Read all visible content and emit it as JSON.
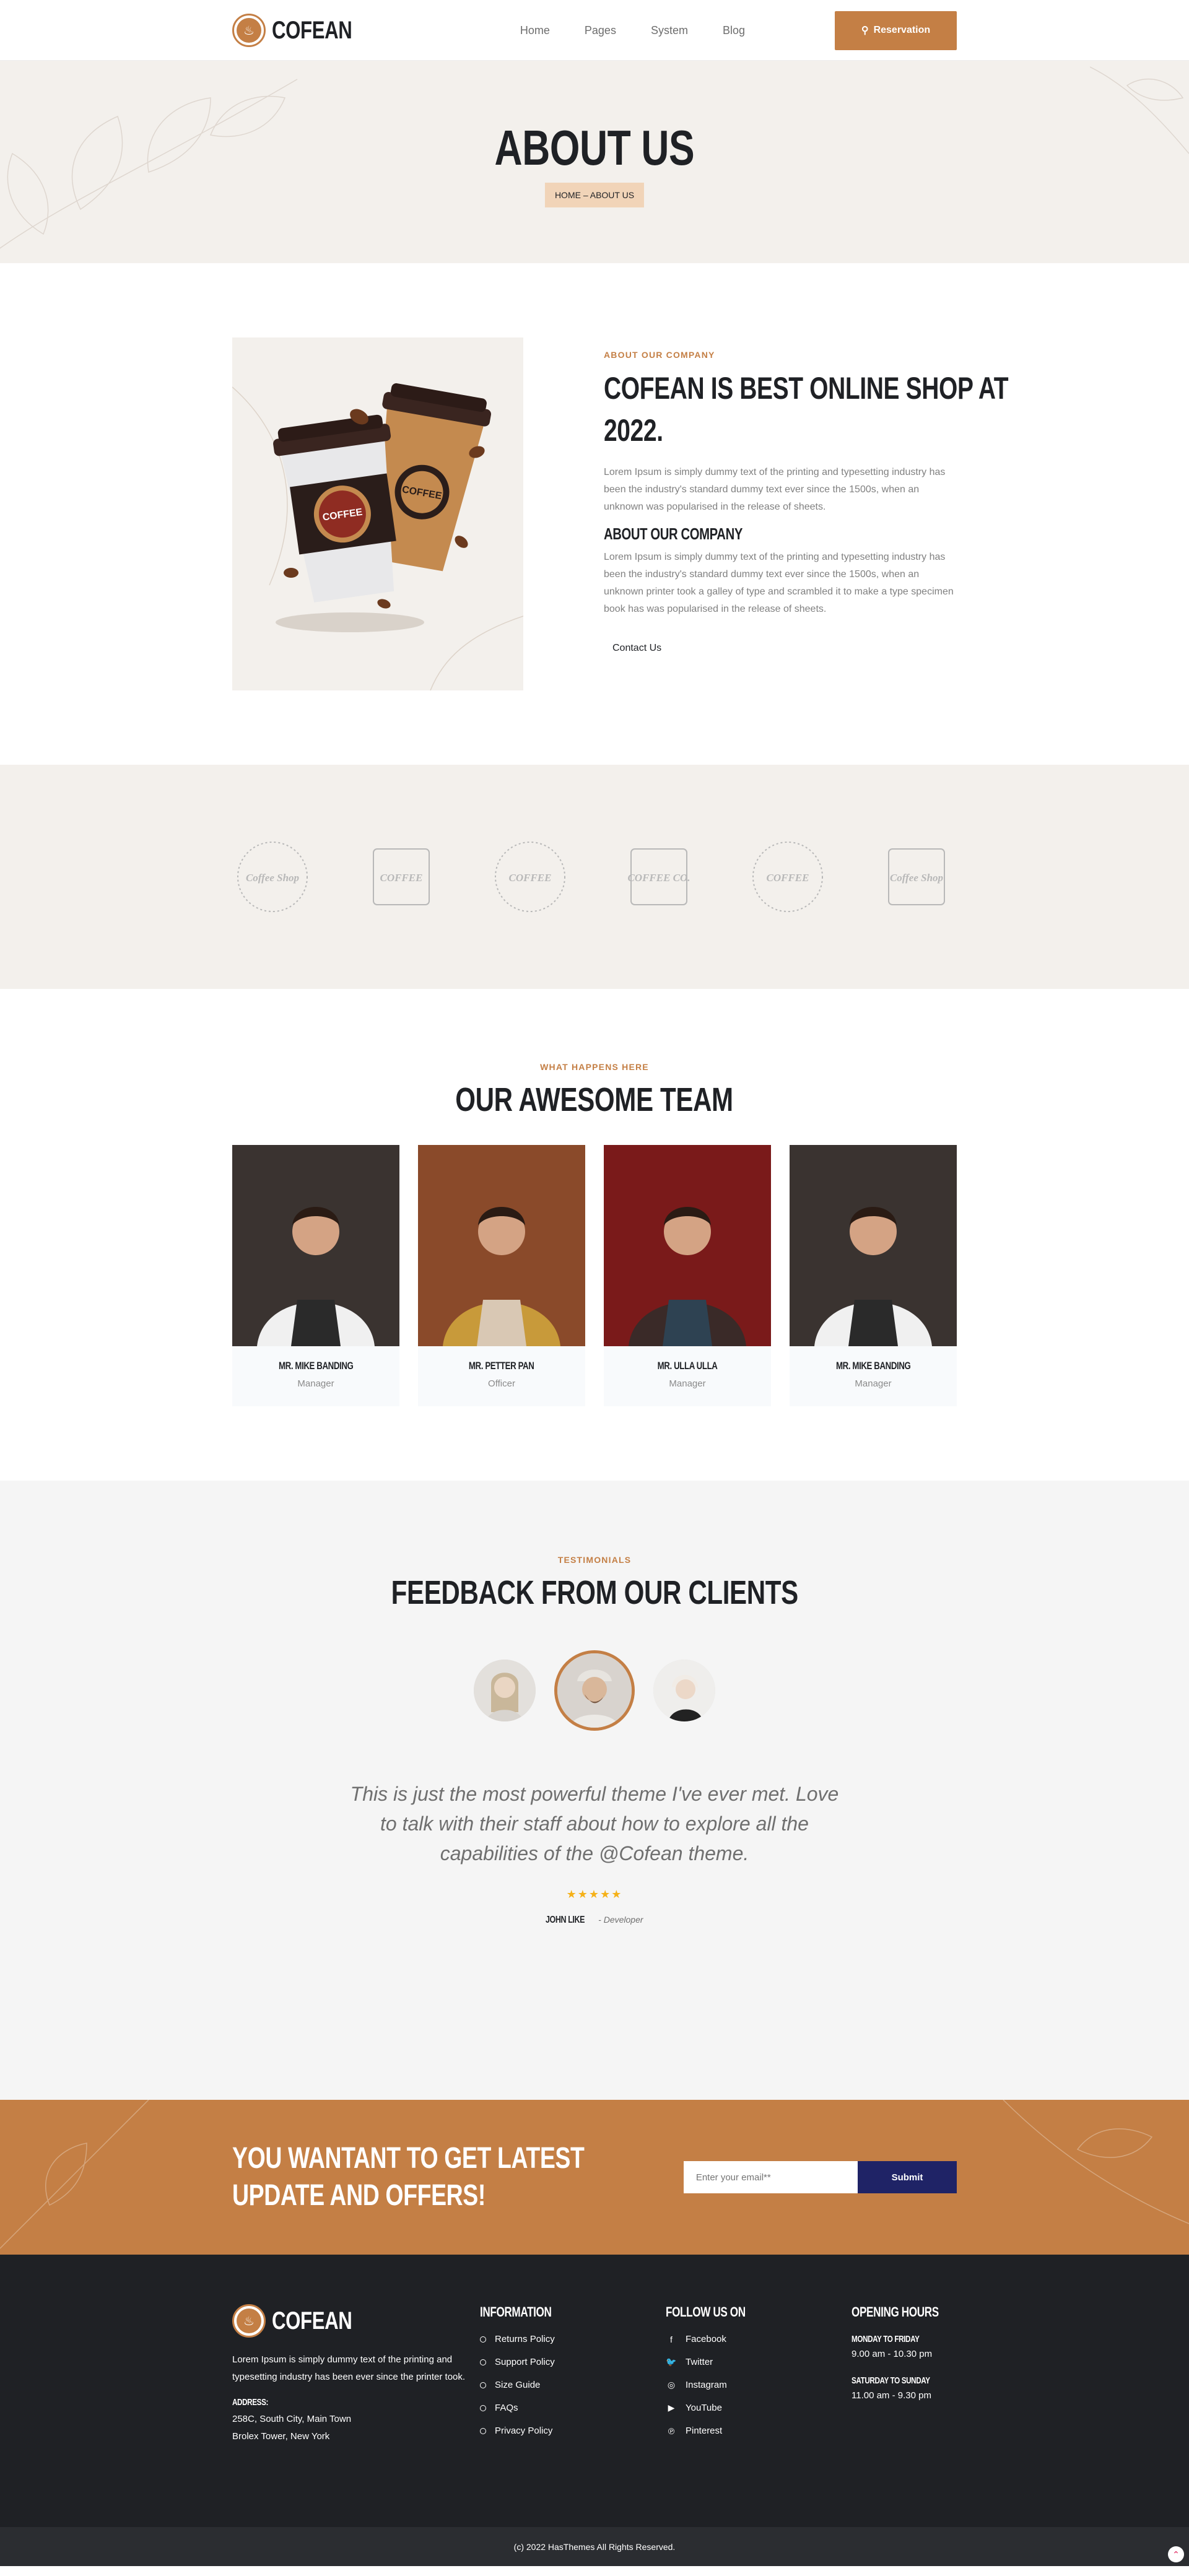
{
  "header": {
    "logo_text": "COFEAN",
    "nav": [
      "Home",
      "Pages",
      "System",
      "Blog"
    ],
    "reservation_label": "Reservation"
  },
  "hero": {
    "title": "ABOUT US",
    "breadcrumb": "HOME – ABOUT US"
  },
  "about": {
    "kicker": "ABOUT OUR COMPANY",
    "title_line1": "COFEAN IS BEST ONLINE SHOP AT",
    "title_line2": "2022.",
    "paragraph1": "Lorem Ipsum is simply dummy text of the printing and typesetting industry has been the industry's standard dummy text ever since the 1500s, when an unknown was popularised in the release of sheets.",
    "subheading": "ABOUT OUR COMPANY",
    "paragraph2": "Lorem Ipsum is simply dummy text of the printing and typesetting industry has been the industry's standard dummy text ever since the 1500s, when an unknown printer took a galley of type and scrambled it to make a type specimen book has was popularised in the release of sheets.",
    "contact_label": "Contact Us",
    "cup_label": "COFFEE"
  },
  "brands": [
    {
      "name": "coffee-shop-logo",
      "text": "Coffee Shop"
    },
    {
      "name": "fresh-brewed-coffee-logo",
      "text": "COFFEE"
    },
    {
      "name": "coffee-company-logo",
      "text": "COFFEE"
    },
    {
      "name": "coffee-co-logo",
      "text": "COFFEE CO."
    },
    {
      "name": "coffee-bag-logo",
      "text": "COFFEE"
    },
    {
      "name": "coffee-shop-logo-2",
      "text": "Coffee Shop"
    }
  ],
  "team": {
    "kicker": "WHAT HAPPENS HERE",
    "title": "OUR AWESOME TEAM",
    "members": [
      {
        "name": "MR. MIKE BANDING",
        "role": "Manager"
      },
      {
        "name": "MR. PETTER PAN",
        "role": "Officer"
      },
      {
        "name": "MR. ULLA ULLA",
        "role": "Manager"
      },
      {
        "name": "MR. MIKE BANDING",
        "role": "Manager"
      }
    ]
  },
  "testimonials": {
    "kicker": "TESTIMONIALS",
    "title": "FEEDBACK FROM OUR CLIENTS",
    "quote": "This is just the most powerful theme I've ever met. Love to talk with their staff about how to explore all the capabilities of the @Cofean theme.",
    "stars": "★★★★★",
    "rating": 5,
    "author_name": "JOHN LIKE",
    "author_role": " - Developer"
  },
  "newsletter": {
    "title_line1": "YOU WANTANT TO GET LATEST",
    "title_line2": "UPDATE AND OFFERS!",
    "placeholder": "Enter your email**",
    "submit_label": "Submit"
  },
  "footer": {
    "logo_text": "COFEAN",
    "description": "Lorem Ipsum is simply dummy text of the printing and typesetting industry has been ever since the printer took.",
    "address_heading": "ADDRESS:",
    "address_line1": "258C, South City, Main Town",
    "address_line2": "Brolex Tower, New York",
    "info_heading": "INFORMATION",
    "info_links": [
      "Returns Policy",
      "Support Policy",
      "Size Guide",
      "FAQs",
      "Privacy Policy"
    ],
    "follow_heading": "FOLLOW US ON",
    "follow_links": [
      {
        "label": "Facebook",
        "icon": "facebook-icon",
        "glyph": "f"
      },
      {
        "label": "Twitter",
        "icon": "twitter-icon",
        "glyph": "🐦"
      },
      {
        "label": "Instagram",
        "icon": "instagram-icon",
        "glyph": "◎"
      },
      {
        "label": "YouTube",
        "icon": "youtube-icon",
        "glyph": "▶"
      },
      {
        "label": "Pinterest",
        "icon": "pinterest-icon",
        "glyph": "℗"
      }
    ],
    "hours_heading": "OPENING HOURS",
    "hours": [
      {
        "day": "MONDAY TO FRIDAY",
        "time": "9.00 am - 10.30 pm"
      },
      {
        "day": "SATURDAY TO SUNDAY",
        "time": "11.00 am - 9.30 pm"
      }
    ],
    "copyright": "(c) 2022 HasThemes All Rights Reserved."
  },
  "colors": {
    "accent": "#c47f45",
    "dark": "#1f2125",
    "hero_bg": "#f3f0ec",
    "submit_bg": "#1f2366"
  }
}
